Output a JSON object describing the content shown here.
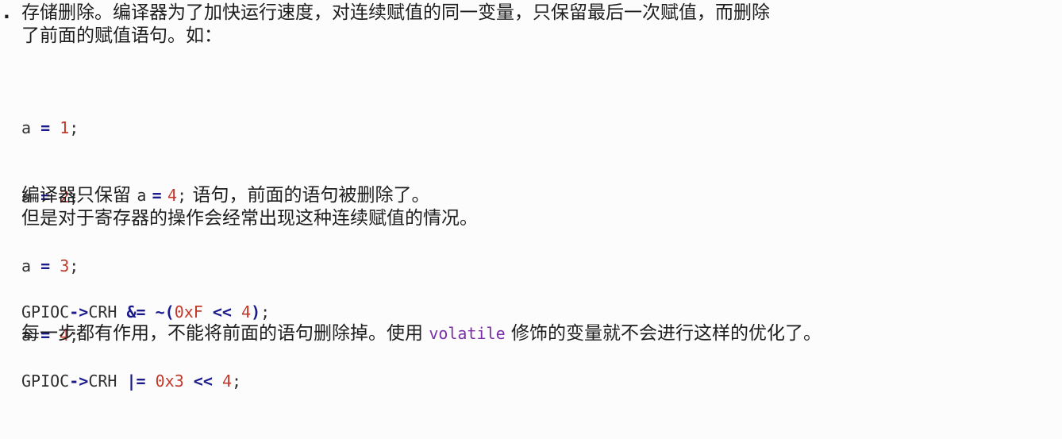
{
  "bullet": ".",
  "intro": {
    "line1": "存储删除。编译器为了加快运行速度，对连续赋值的同一变量，只保留最后一次赋值，而删除",
    "line2": "了前面的赋值语句。如："
  },
  "code_assignments": [
    {
      "ident": "a",
      "op": "=",
      "value": "1",
      "end": ";"
    },
    {
      "ident": "a",
      "op": "=",
      "value": "2",
      "end": ";"
    },
    {
      "ident": "a",
      "op": "=",
      "value": "3",
      "end": ";"
    },
    {
      "ident": "a",
      "op": "=",
      "value": "4",
      "end": ";"
    }
  ],
  "explain": {
    "prefix": "编译器只保留",
    "code_ident": "a",
    "code_op": "=",
    "code_value": "4",
    "code_end": ";",
    "suffix": "语句，前面的语句被删除了。",
    "line2": "但是对于寄存器的操作会经常出现这种连续赋值的情况。"
  },
  "code_registers": {
    "line1": {
      "reg": "GPIOC",
      "arrow": "->",
      "field": "CRH",
      "op": "&=",
      "tilde": "~",
      "open": "(",
      "mask": "0xF",
      "shift": "<<",
      "amount": "4",
      "close": ")",
      "end": ";"
    },
    "line2": {
      "reg": "GPIOC",
      "arrow": "->",
      "field": "CRH",
      "op": "|=",
      "value": "0x3",
      "shift": "<<",
      "amount": "4",
      "end": ";"
    }
  },
  "conclusion": {
    "prefix": "每一步都有作用，不能将前面的语句删除掉。使用",
    "keyword": "volatile",
    "suffix": "修饰的变量就不会进行这样的优化了。"
  },
  "colors": {
    "operator": "#1a1a8c",
    "number": "#c0392b",
    "keyword": "#7b2fa8",
    "text": "#1e1e1e"
  }
}
